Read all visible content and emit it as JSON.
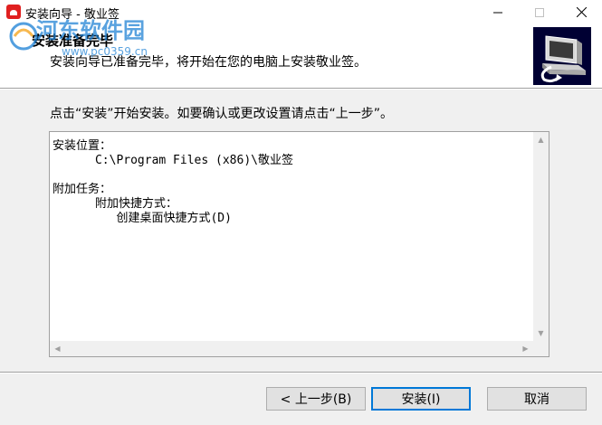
{
  "window": {
    "title": "安装向导 - 敬业签",
    "controls": [
      "minimize-icon",
      "maximize-icon",
      "close-icon"
    ]
  },
  "watermark": {
    "brand": "河东软件园",
    "url": "www.pc0359.cn"
  },
  "header": {
    "title": "安装准备完毕",
    "subtitle": "安装向导已准备完毕，将开始在您的电脑上安装敬业签。",
    "image_icon": "computer-install-icon"
  },
  "main": {
    "instruction": "点击“安装”开始安装。如要确认或更改设置请点击“上一步”。",
    "memo_lines": [
      "安装位置：",
      "      C:\\Program Files (x86)\\敬业签",
      "",
      "附加任务：",
      "      附加快捷方式：",
      "         创建桌面快捷方式(D)"
    ]
  },
  "buttons": {
    "back": "< 上一步(B)",
    "install": "安装(I)",
    "cancel": "取消"
  },
  "colors": {
    "accent": "#0078d7",
    "header_image_bg": "#000033",
    "watermark": "#1a7fd4"
  }
}
